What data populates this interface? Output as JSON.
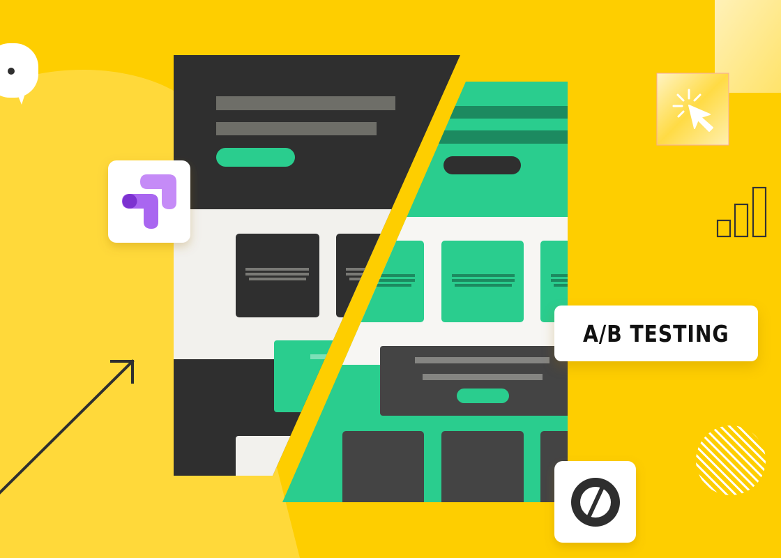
{
  "badge": {
    "label": "A/B TESTING"
  },
  "colors": {
    "background": "#FECE00",
    "dark": "#2F2F2F",
    "green": "#2ACD8E",
    "dark_green": "#1C8A60",
    "light": "#F2F1ED",
    "purple": "#A66AF0"
  },
  "icons": {
    "speech_bubble": "speech-bubble-icon",
    "google_optimize": "google-optimize-logo",
    "cursor_click": "cursor-click-icon",
    "bar_chart": "bar-chart-icon",
    "unbounce": "unbounce-logo",
    "trend_arrow": "arrow-up-right-icon",
    "hatched_circle": "hatched-circle-decoration"
  }
}
